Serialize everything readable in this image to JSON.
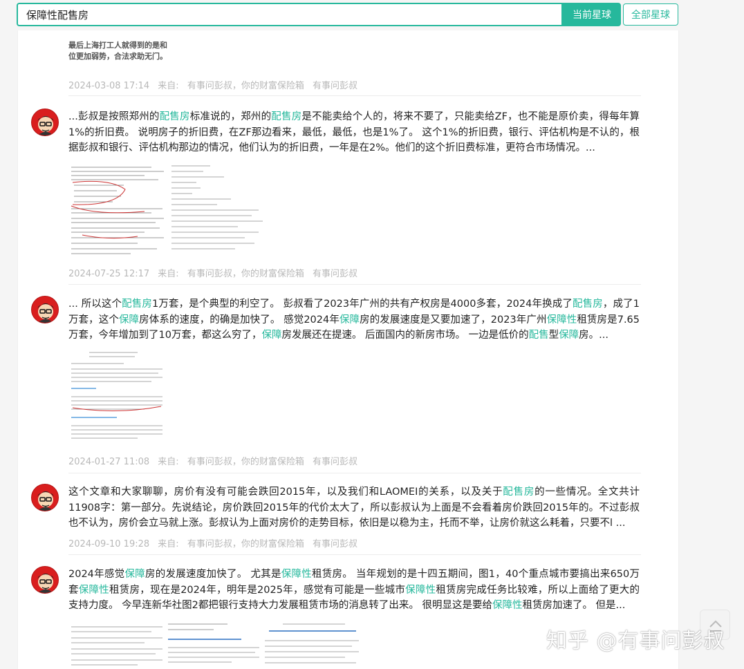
{
  "search": {
    "value": "保障性配售房",
    "btn_current": "当前星球",
    "btn_all": "全部星球"
  },
  "colors": {
    "accent": "#26b89c",
    "avatar_bg": "#d91e1e"
  },
  "posts": [
    {
      "snippet_lines": [
        "最后上海打工人就得到的是和",
        "位更加弱势，合法求助无门。"
      ],
      "date": "2024-03-08 17:14",
      "source_label": "来自:",
      "sources": [
        "有事问彭叔，你的财富保险箱",
        "有事问彭叔"
      ]
    },
    {
      "text": [
        {
          "t": "...彭叔是按照郑州的"
        },
        {
          "t": "配售房",
          "h": 1
        },
        {
          "t": "标准说的，郑州的"
        },
        {
          "t": "配售房",
          "h": 1
        },
        {
          "t": "是不能卖给个人的，将来不要了，只能卖给ZF，也不能是原价卖，得每年算1%的折旧费。 说明房子的折旧费，在ZF那边看来，最低，最低，也是1%了。  这个1%的折旧费，银行、评估机构是不认的，根据彭叔和银行、评估机构那边的情况，他们认为的折旧费，一年是在2%。他们的这个折旧费标准，更符合市场情况。..."
        }
      ],
      "avatar_icon": "avatar-icon",
      "date": "2024-07-25 12:17",
      "source_label": "来自:",
      "sources": [
        "有事问彭叔，你的财富保险箱",
        "有事问彭叔"
      ]
    },
    {
      "text": [
        {
          "t": "... 所以这个"
        },
        {
          "t": "配售房",
          "h": 1
        },
        {
          "t": "1万套，是个典型的利空了。 彭叔看了2023年广州的共有产权房是4000多套，2024年换成了"
        },
        {
          "t": "配售房",
          "h": 1
        },
        {
          "t": "，成了1万套，这个"
        },
        {
          "t": "保障",
          "h": 1
        },
        {
          "t": "房体系的速度，的确是加快了。  感觉2024年"
        },
        {
          "t": "保障",
          "h": 1
        },
        {
          "t": "房的发展速度是又要加速了，2023年广州"
        },
        {
          "t": "保障性",
          "h": 1
        },
        {
          "t": "租赁房是7.65万套，今年增加到了10万套，都这么穷了，"
        },
        {
          "t": "保障",
          "h": 1
        },
        {
          "t": "房发展还在提速。 后面国内的新房市场。 一边是低价的"
        },
        {
          "t": "配售",
          "h": 1
        },
        {
          "t": "型"
        },
        {
          "t": "保障",
          "h": 1
        },
        {
          "t": "房。..."
        }
      ],
      "date": "2024-01-27 11:08",
      "source_label": "来自:",
      "sources": [
        "有事问彭叔，你的财富保险箱",
        "有事问彭叔"
      ]
    },
    {
      "text": [
        {
          "t": "这个文章和大家聊聊，房价有没有可能会跌回2015年，以及我们和LAOMEI的关系，以及关于"
        },
        {
          "t": "配售房",
          "h": 1
        },
        {
          "t": "的一些情况。全文共计11908字：第一部分。先说结论，房价跌回2015年的代价太大了，所以彭叔认为上面是不会看着房价跌回2015年的。不过彭叔也不认为，房价会立马就上涨。彭叔认为上面对房价的走势目标，依旧是以稳为主，托而不举，让房价就这么耗着，只要不l ..."
        }
      ],
      "date": "2024-09-10 19:28",
      "source_label": "来自:",
      "sources": [
        "有事问彭叔，你的财富保险箱",
        "有事问彭叔"
      ]
    },
    {
      "text": [
        {
          "t": "2024年感觉"
        },
        {
          "t": "保障",
          "h": 1
        },
        {
          "t": "房的发展速度加快了。 尤其是"
        },
        {
          "t": "保障性",
          "h": 1
        },
        {
          "t": "租赁房。 当年规划的是十四五期间，图1，40个重点城市要搞出来650万套"
        },
        {
          "t": "保障性",
          "h": 1
        },
        {
          "t": "租赁房，现在是2024年，明年是2025年，感觉有可能是一些城市"
        },
        {
          "t": "保障性",
          "h": 1
        },
        {
          "t": "租赁房完成任务比较难，所以上面给了更大的支持力度。 今早连新华社图2都把银行支持大力发展租赁市场的消息转了出来。 很明显这是要给"
        },
        {
          "t": "保障性",
          "h": 1
        },
        {
          "t": "租赁房加速了。 但是..."
        }
      ],
      "date": "",
      "source_label": "",
      "sources": []
    }
  ],
  "watermark": "知乎 @有事问彭叔"
}
